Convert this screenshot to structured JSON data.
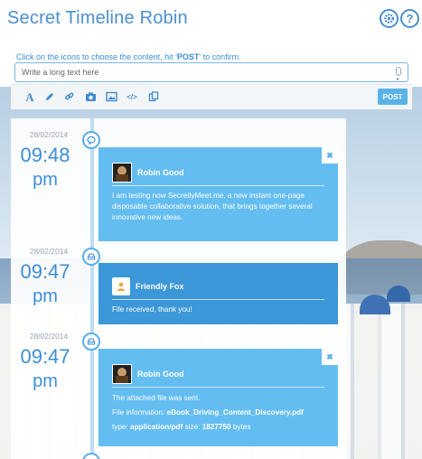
{
  "app": {
    "title": "Secret Timeline Robin"
  },
  "header": {
    "settings_icon": "gear-icon",
    "help_label": "?"
  },
  "composer": {
    "hint_prefix": "Click on the icons to choose the content, hit '",
    "hint_bold": "POST",
    "hint_suffix": "' to confirm.",
    "placeholder": "Write a long text here",
    "post_label": "POST",
    "tools": [
      {
        "name": "text-icon",
        "glyph": "A"
      },
      {
        "name": "pencil-icon",
        "glyph": "✎"
      },
      {
        "name": "link-icon",
        "glyph": "🔗"
      },
      {
        "name": "camera-icon",
        "glyph": "📷"
      },
      {
        "name": "image-icon",
        "glyph": "▣"
      },
      {
        "name": "code-icon",
        "glyph": "</>"
      },
      {
        "name": "file-icon",
        "glyph": "⧉"
      }
    ]
  },
  "colors": {
    "accent": "#4a8fd0",
    "card_light": "#63bdf1",
    "card_dark": "#3b97d8",
    "post_button": "#5ab3e8"
  },
  "timeline": {
    "entries": [
      {
        "date": "28/02/2014",
        "time": "09:48",
        "ampm": "pm",
        "node_icon": "chat-bubble-icon",
        "author": "Robin Good",
        "body": "I am testing now SecretlyMeet.me, a new instant one-page disposable collaborative solution, that brings together several innovative new ideas."
      },
      {
        "date": "28/02/2014",
        "time": "09:47",
        "ampm": "pm",
        "node_icon": "inbox-icon",
        "author": "Friendly Fox",
        "body": "File received, thank you!"
      },
      {
        "date": "28/02/2014",
        "time": "09:47",
        "ampm": "pm",
        "node_icon": "inbox-icon",
        "author": "Robin Good",
        "body_line1": "The attached file was sent.",
        "file_info_label": "File information:",
        "file_name": "eBook_Driving_Content_Discovery.pdf",
        "type_label": "type:",
        "type_value": "application/pdf",
        "size_label": "size:",
        "size_value": "1827750",
        "size_unit": "bytes"
      }
    ]
  }
}
